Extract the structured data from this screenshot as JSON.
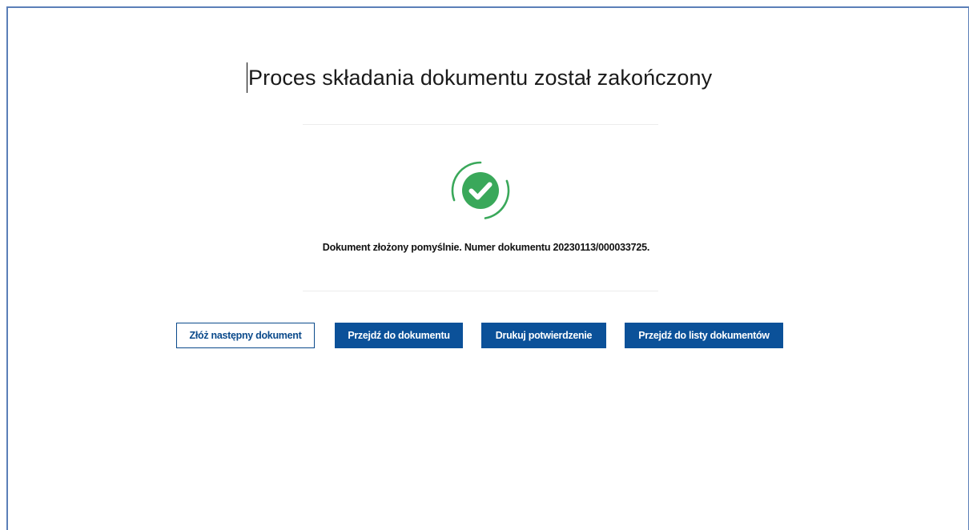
{
  "page": {
    "title": "Proces składania dokumentu został zakończony"
  },
  "status": {
    "icon": "success-check-icon",
    "color": "#3aa85a",
    "message": "Dokument złożony pomyślnie. Numer dokumentu 20230113/000033725."
  },
  "actions": {
    "next_document": "Złóż następny dokument",
    "go_to_document": "Przejdź do dokumentu",
    "print_confirmation": "Drukuj potwierdzenie",
    "go_to_document_list": "Przejdź do listy dokumentów"
  },
  "colors": {
    "primary": "#0b5199",
    "frame_border": "#5b7fb8",
    "success": "#3aa85a"
  }
}
